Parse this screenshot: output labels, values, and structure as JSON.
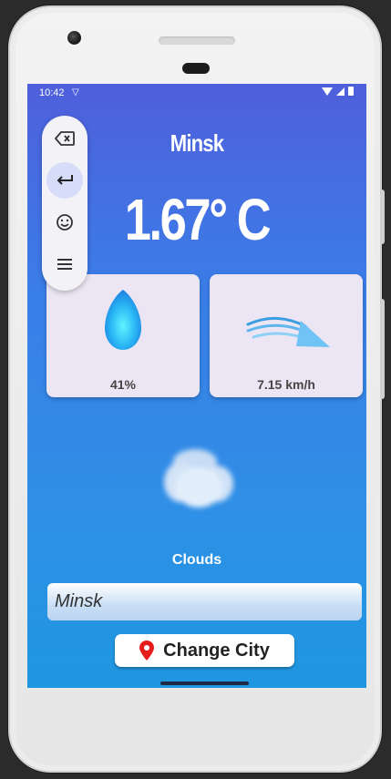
{
  "status": {
    "time": "10:42",
    "vpn_icon": "shield-icon"
  },
  "weather": {
    "city": "Minsk",
    "temperature": "1.67° C",
    "humidity": "41%",
    "wind_speed": "7.15 km/h",
    "condition": "Clouds"
  },
  "form": {
    "city_value": "Minsk",
    "button_label": "Change City"
  },
  "keyboard_toolbar": [
    "backspace-icon",
    "enter-icon",
    "emoji-icon",
    "menu-icon"
  ],
  "colors": {
    "gradient_top": "#4f5fdb",
    "gradient_bottom": "#1f97e0",
    "card_bg": "#ece6f4",
    "pin": "#e41c1c"
  }
}
